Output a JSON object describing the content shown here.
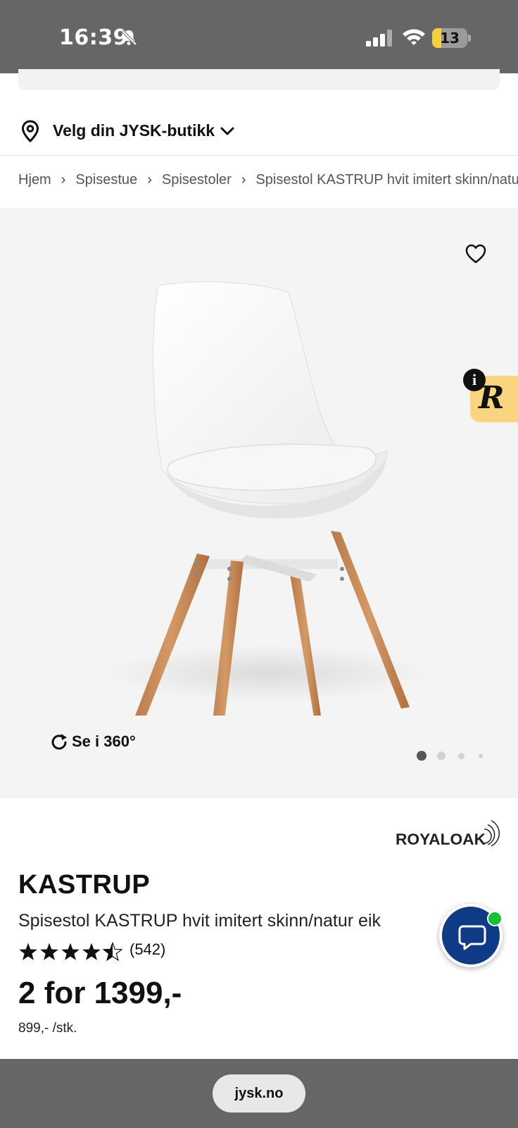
{
  "status_bar": {
    "time": "16:39",
    "battery_level": "13",
    "battery_fraction": 0.13,
    "icons": [
      "bell-slash-icon",
      "cellular-signal-icon",
      "wifi-icon",
      "battery-icon"
    ]
  },
  "store_selector": {
    "label": "Velg din JYSK-butikk"
  },
  "breadcrumb": {
    "items": [
      "Hjem",
      "Spisestue",
      "Spisestoler",
      "Spisestol KASTRUP hvit imitert skinn/natur eik"
    ],
    "separator": "›"
  },
  "gallery": {
    "view360_label": "Se i 360°",
    "slide_count": 4,
    "active_slide": 1,
    "background": "#f4f4f4"
  },
  "reviews_badge": {
    "letter": "R",
    "info": "i"
  },
  "product": {
    "brand": "ROYALOAK",
    "name": "KASTRUP",
    "description": "Spisestol KASTRUP hvit imitert skinn/natur eik",
    "rating": 4.5,
    "rating_max": 5,
    "review_count": "(542)",
    "price": "2 for 1399,-",
    "unit_price": "899,- /stk."
  },
  "browser": {
    "url": "jysk.no"
  },
  "colors": {
    "chrome_gray": "#666666",
    "chat_blue": "#0f3a86",
    "online_green": "#14c233",
    "badge_yellow": "#f8d57e"
  }
}
